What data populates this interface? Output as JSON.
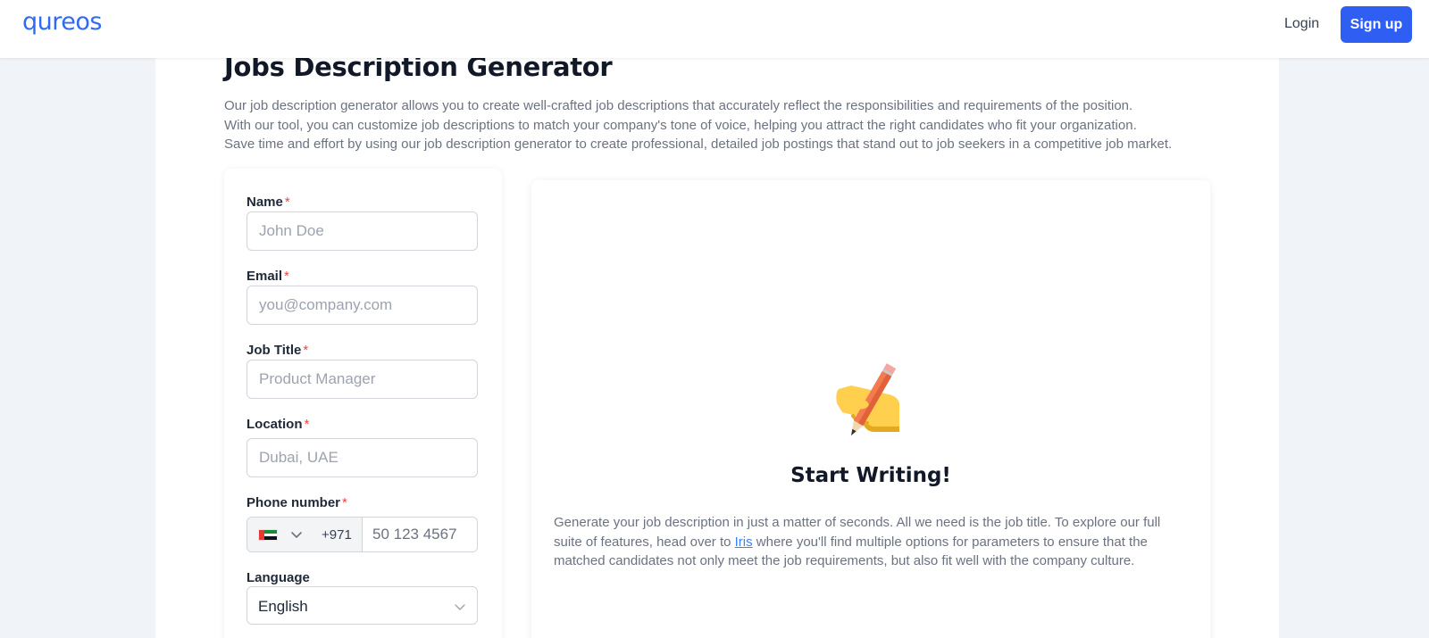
{
  "nav": {
    "logo": "qureos",
    "login": "Login",
    "signup": "Sign up"
  },
  "page": {
    "title": "Jobs Description Generator",
    "intro": [
      "Our job description generator allows you to create well-crafted job descriptions that accurately reflect the responsibilities and requirements of the position.",
      "With our tool, you can customize job descriptions to match your company's tone of voice, helping you attract the right candidates who fit your organization.",
      "Save time and effort by using our job description generator to create professional, detailed job postings that stand out to job seekers in a competitive job market."
    ]
  },
  "form": {
    "required_mark": "*",
    "name": {
      "label": "Name",
      "placeholder": "John Doe"
    },
    "email": {
      "label": "Email",
      "placeholder": "you@company.com"
    },
    "job_title": {
      "label": "Job Title",
      "placeholder": "Product Manager"
    },
    "location": {
      "label": "Location",
      "placeholder": "Dubai, UAE"
    },
    "phone": {
      "label": "Phone number",
      "country": "United Arab Emirates",
      "dial_code": "+971",
      "placeholder": "50 123 4567"
    },
    "language": {
      "label": "Language",
      "value": "English"
    }
  },
  "preview": {
    "icon": "writing-hand-icon",
    "title": "Start Writing!",
    "desc_before": "Generate your job description in just a matter of seconds. All we need is the job title. To explore our full suite of features, head over to ",
    "link_text": "Iris",
    "desc_after": " where you'll find multiple options for parameters to ensure that the matched candidates not only meet the job requirements, but also fit well with the company culture."
  },
  "colors": {
    "brand_blue": "#2f5ff2",
    "required_red": "#ef4444",
    "page_background": "#f0f3f7"
  }
}
